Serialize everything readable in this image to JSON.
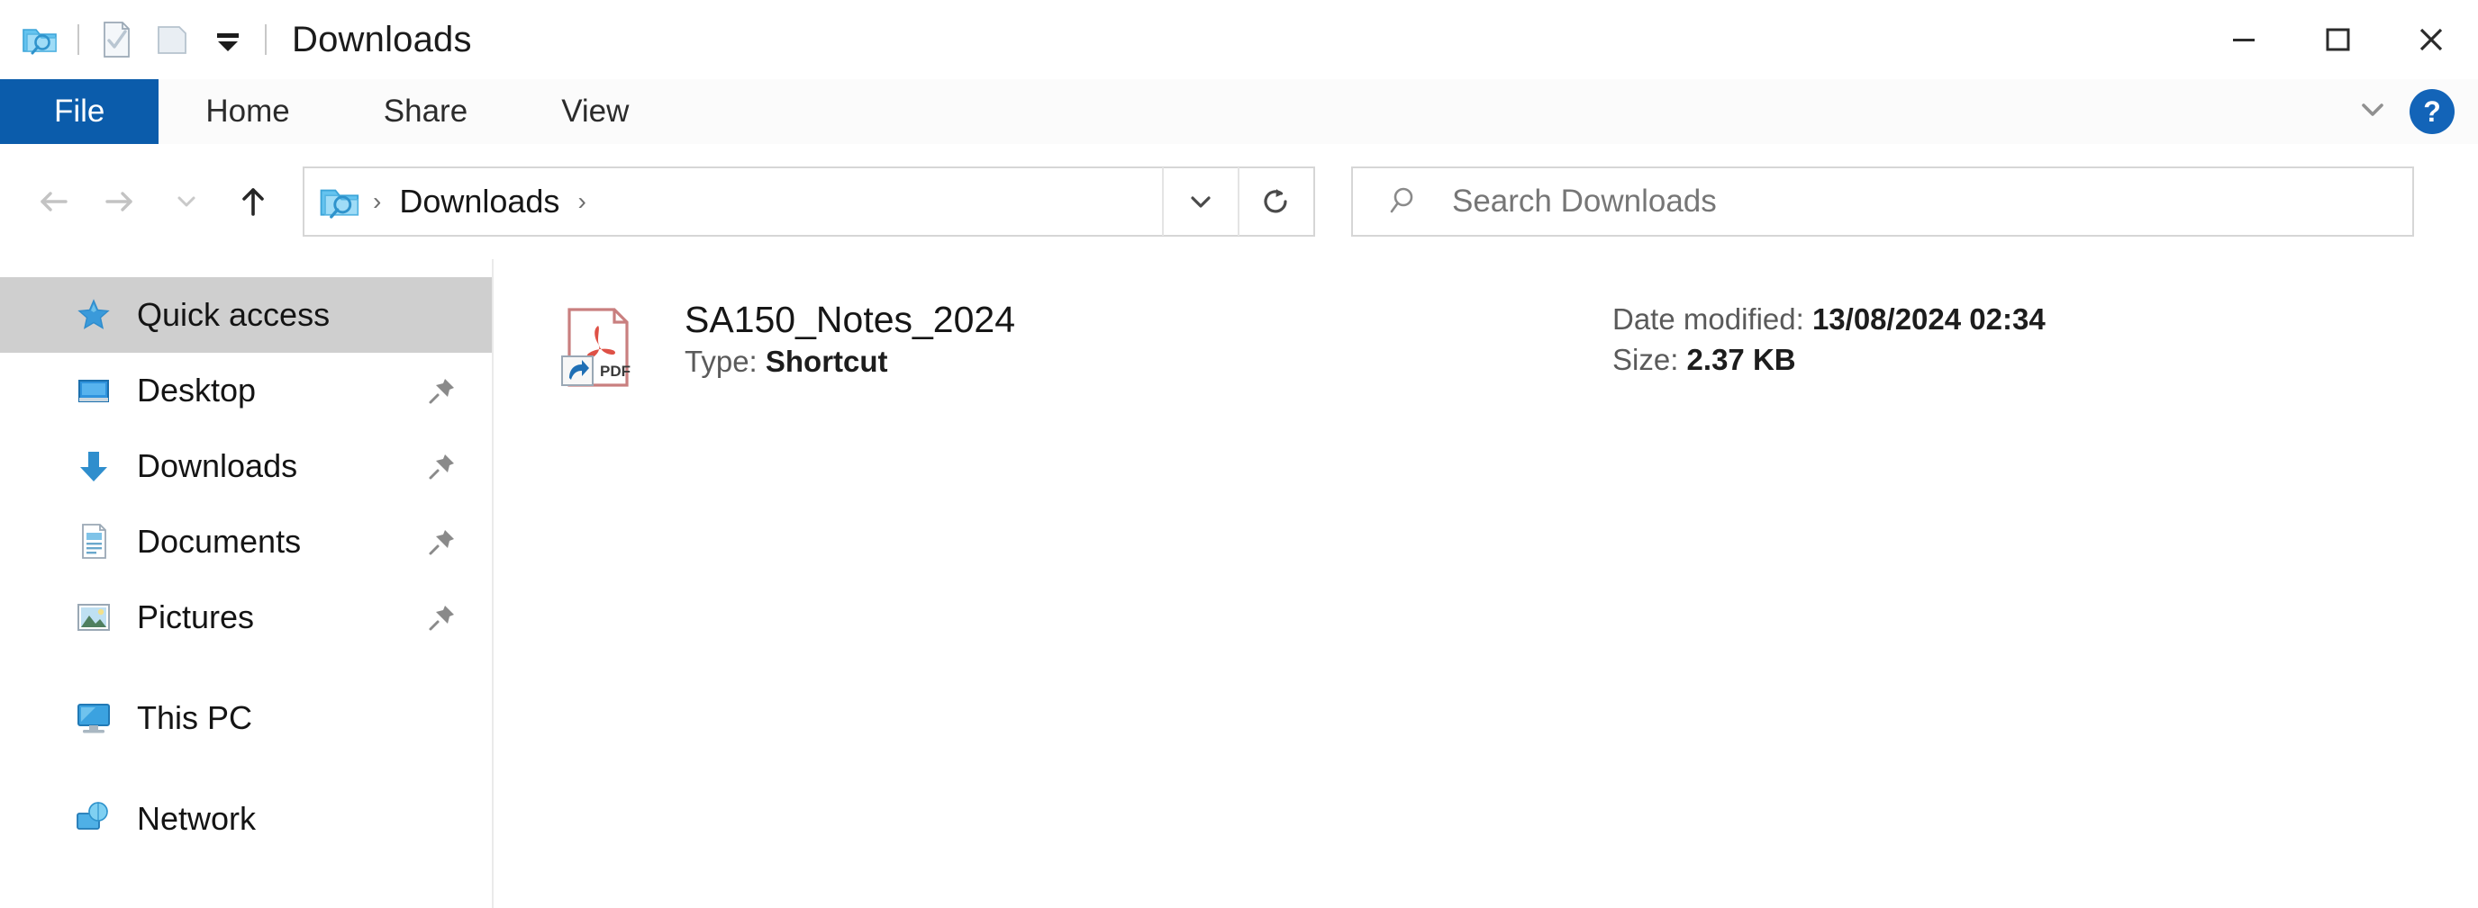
{
  "window": {
    "title": "Downloads",
    "quick_access_toolbar": [
      {
        "name": "explorer-icon",
        "label": "File Explorer"
      },
      {
        "name": "properties-icon",
        "label": "Properties"
      },
      {
        "name": "new-folder-icon",
        "label": "New folder"
      },
      {
        "name": "customize-qat-icon",
        "label": "Customize Quick Access Toolbar"
      }
    ],
    "controls": {
      "minimize": "—",
      "maximize": "☐",
      "close": "✕"
    }
  },
  "ribbon": {
    "tabs": [
      {
        "label": "File",
        "active": true
      },
      {
        "label": "Home",
        "active": false
      },
      {
        "label": "Share",
        "active": false
      },
      {
        "label": "View",
        "active": false
      }
    ],
    "expand_label": "⌄",
    "help_label": "?"
  },
  "navigation": {
    "back_label": "←",
    "forward_label": "→",
    "recent_label": "⌄",
    "up_label": "↑",
    "breadcrumb": {
      "folder_icon": "downloads-folder-icon",
      "separator": "›",
      "items": [
        "Downloads"
      ]
    },
    "dropdown_label": "⌄",
    "refresh_label": "↻"
  },
  "search": {
    "placeholder": "Search Downloads",
    "value": "",
    "icon": "search-icon"
  },
  "sidebar": {
    "items": [
      {
        "label": "Quick access",
        "icon": "star-icon",
        "selected": true,
        "pinned": false,
        "level": "root"
      },
      {
        "label": "Desktop",
        "icon": "desktop-icon",
        "selected": false,
        "pinned": true,
        "level": "child"
      },
      {
        "label": "Downloads",
        "icon": "downloads-arrow-icon",
        "selected": false,
        "pinned": true,
        "level": "child"
      },
      {
        "label": "Documents",
        "icon": "documents-icon",
        "selected": false,
        "pinned": true,
        "level": "child"
      },
      {
        "label": "Pictures",
        "icon": "pictures-icon",
        "selected": false,
        "pinned": true,
        "level": "child"
      },
      {
        "label": "This PC",
        "icon": "this-pc-icon",
        "selected": false,
        "pinned": false,
        "level": "root"
      },
      {
        "label": "Network",
        "icon": "network-icon",
        "selected": false,
        "pinned": false,
        "level": "root"
      }
    ]
  },
  "files": [
    {
      "name": "SA150_Notes_2024",
      "type_label": "Type:",
      "type_value": "Shortcut",
      "date_label": "Date modified:",
      "date_value": "13/08/2024 02:34",
      "size_label": "Size:",
      "size_value": "2.37 KB",
      "icon": "pdf-shortcut-icon"
    }
  ],
  "colors": {
    "file_tab_blue": "#0b5cab",
    "help_blue": "#1364b8",
    "selection_gray": "#cfcfcf",
    "accent_blue": "#3a9ada",
    "pdf_red": "#c0392b"
  }
}
